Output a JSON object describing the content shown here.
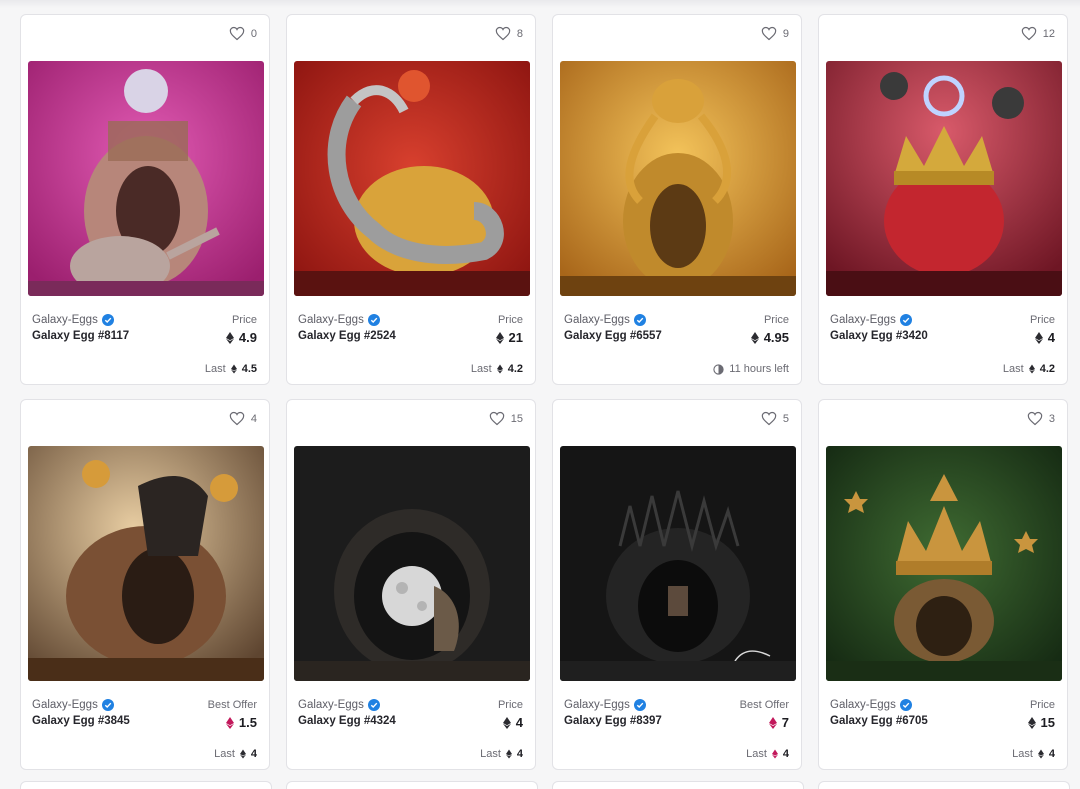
{
  "cards": [
    {
      "likes": "0",
      "collection": "Galaxy-Eggs",
      "name": "Galaxy Egg #8117",
      "price_label": "Price",
      "price": "4.9",
      "price_color": "#2b2b30",
      "footer_type": "last",
      "footer_label": "Last",
      "footer_value": "4.5",
      "art_theme": "magenta-teapot",
      "bg": "#c9338f"
    },
    {
      "likes": "8",
      "collection": "Galaxy-Eggs",
      "name": "Galaxy Egg #2524",
      "price_label": "Price",
      "price": "21",
      "price_color": "#2b2b30",
      "footer_type": "last",
      "footer_label": "Last",
      "footer_value": "4.2",
      "art_theme": "red-silver-dragon",
      "bg": "#b9221c"
    },
    {
      "likes": "9",
      "collection": "Galaxy-Eggs",
      "name": "Galaxy Egg #6557",
      "price_label": "Price",
      "price": "4.95",
      "price_color": "#2b2b30",
      "footer_type": "timer",
      "footer_label": "11 hours left",
      "footer_value": "",
      "art_theme": "gold-octopus",
      "bg": "#c98e25"
    },
    {
      "likes": "12",
      "collection": "Galaxy-Eggs",
      "name": "Galaxy Egg #3420",
      "price_label": "Price",
      "price": "4",
      "price_color": "#2b2b30",
      "footer_type": "last",
      "footer_label": "Last",
      "footer_value": "4.2",
      "art_theme": "red-crown",
      "bg": "#9c2233"
    },
    {
      "likes": "4",
      "collection": "Galaxy-Eggs",
      "name": "Galaxy Egg #3845",
      "price_label": "Best Offer",
      "price": "1.5",
      "price_color": "#c2185b",
      "footer_type": "last",
      "footer_label": "Last",
      "footer_value": "4",
      "art_theme": "bronze-warriors",
      "bg": "#8a6a48"
    },
    {
      "likes": "15",
      "collection": "Galaxy-Eggs",
      "name": "Galaxy Egg #4324",
      "price_label": "Price",
      "price": "4",
      "price_color": "#2b2b30",
      "footer_type": "last",
      "footer_label": "Last",
      "footer_value": "4",
      "art_theme": "dark-moon",
      "bg": "#1b1b1b"
    },
    {
      "likes": "5",
      "collection": "Galaxy-Eggs",
      "name": "Galaxy Egg #8397",
      "price_label": "Best Offer",
      "price": "7",
      "price_color": "#c2185b",
      "footer_type": "last",
      "footer_label": "Last",
      "footer_value": "4",
      "art_theme": "dark-throne",
      "bg": "#161616"
    },
    {
      "likes": "3",
      "collection": "Galaxy-Eggs",
      "name": "Galaxy Egg #6705",
      "price_label": "Price",
      "price": "15",
      "price_color": "#2b2b30",
      "footer_type": "last",
      "footer_label": "Last",
      "footer_value": "4",
      "art_theme": "green-crown",
      "bg": "#24421f"
    }
  ],
  "colors": {
    "verified": "#2081e2",
    "offer_eth": "#c2185b",
    "eth": "#2b2b30"
  }
}
